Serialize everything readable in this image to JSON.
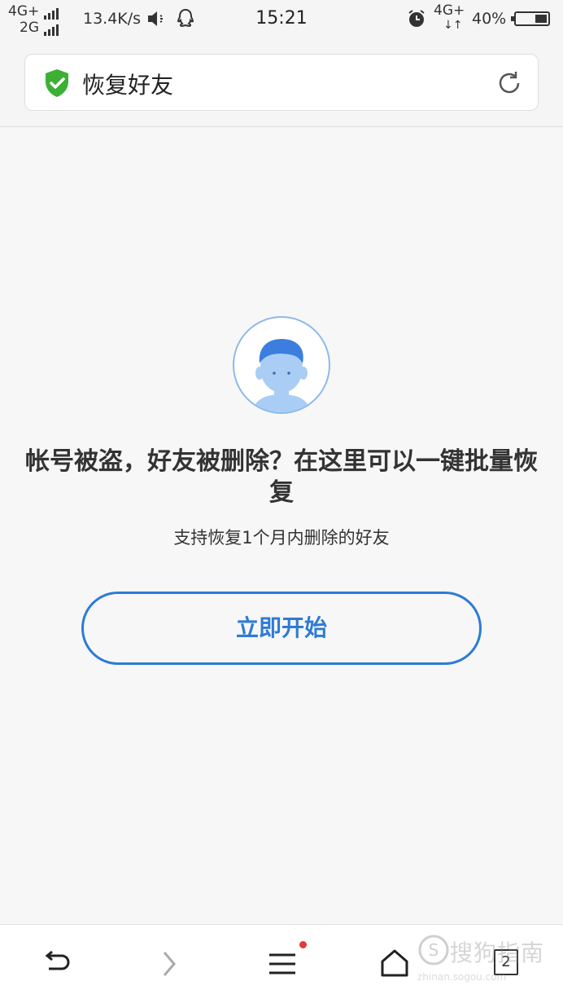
{
  "status_bar": {
    "network_top": "4G+",
    "network_bottom": "2G",
    "speed": "13.4K/s",
    "time": "15:21",
    "network_right": "4G+",
    "battery": "40%",
    "icons": [
      "speaker-muted-icon",
      "qq-icon",
      "alarm-icon",
      "battery-icon"
    ]
  },
  "header": {
    "title": "恢复好友",
    "shield_color": "#3cb034",
    "icons": [
      "shield-check-icon",
      "reload-icon"
    ]
  },
  "main": {
    "avatar_icon": "user-avatar-icon",
    "headline": "帐号被盗，好友被删除？在这里可以一键批量恢复",
    "subline": "支持恢复1个月内删除的好友",
    "start_button": "立即开始",
    "accent_color": "#2d7bd6"
  },
  "bottom_nav": {
    "tabs_count": "2",
    "icons": [
      "back-icon",
      "forward-icon",
      "menu-icon",
      "home-icon",
      "tabs-icon"
    ],
    "notification_color": "#e53935"
  },
  "watermark": {
    "text": "搜狗指南",
    "url": "zhinan.sogou.com"
  }
}
